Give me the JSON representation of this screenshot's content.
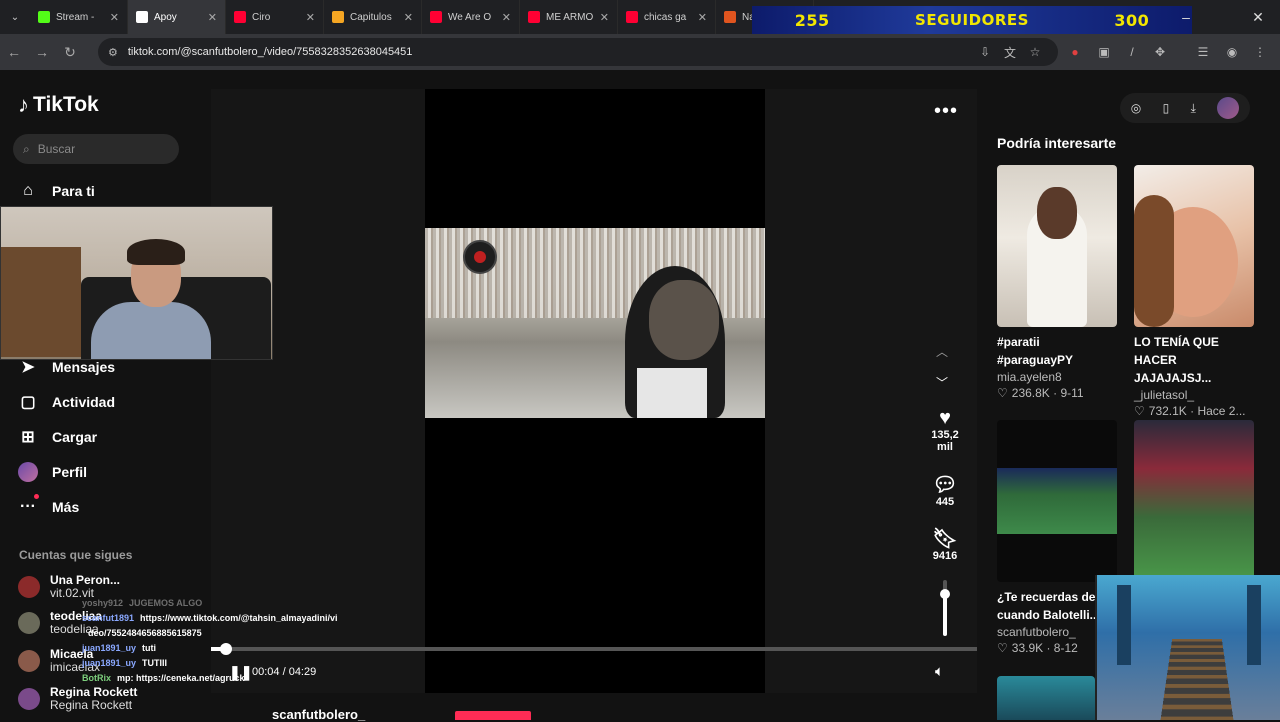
{
  "browser": {
    "tabs": [
      {
        "label": "Stream -",
        "color": "#53fc18",
        "active": false
      },
      {
        "label": "Apoy",
        "color": "#ffffff",
        "active": true
      },
      {
        "label": "Ciro",
        "color": "#ff0033",
        "active": false
      },
      {
        "label": "Capitulos",
        "color": "#f5a623",
        "active": false
      },
      {
        "label": "We Are O",
        "color": "#ff0033",
        "active": false
      },
      {
        "label": "ME ARMO",
        "color": "#ff0033",
        "active": false
      },
      {
        "label": "chicas ga",
        "color": "#ff0033",
        "active": false
      },
      {
        "label": "Naruto",
        "color": "#e0551f",
        "active": false
      }
    ],
    "url": "tiktok.com/@scanfutbolero_/video/7558328352638045451"
  },
  "overlay": {
    "count_left": "255",
    "label": "SEGUIDORES",
    "count_right": "300"
  },
  "sidebar": {
    "logo": "TikTok",
    "search_placeholder": "Buscar",
    "nav": [
      {
        "label": "Para ti",
        "icon": "home-icon"
      },
      {
        "label": "Mensajes",
        "icon": "send-icon"
      },
      {
        "label": "Actividad",
        "icon": "inbox-icon"
      },
      {
        "label": "Cargar",
        "icon": "plus-square-icon"
      },
      {
        "label": "Perfil",
        "icon": "avatar"
      },
      {
        "label": "Más",
        "icon": "more-icon"
      }
    ],
    "following_heading": "Cuentas que sigues",
    "following": [
      {
        "name": "Una Peron...",
        "handle": "vit.02.vit"
      },
      {
        "name": "teodeliaa",
        "handle": "teodeliaa"
      },
      {
        "name": "Micaela",
        "handle": "imicaelax"
      },
      {
        "name": "Regina Rockett",
        "handle": "Regina Rockett"
      }
    ]
  },
  "chat": [
    {
      "user": "yoshy912",
      "msg": "JUGEMOS ALGO",
      "style": "gray"
    },
    {
      "user": "scanfut1891",
      "msg": "https://www.tiktok.com/@tahsin_almayadini/vi",
      "style": "blue"
    },
    {
      "user": "",
      "msg": "deo/7552484656885615875",
      "style": "blue"
    },
    {
      "user": "juan1891_uy",
      "msg": "tuti",
      "style": "blue"
    },
    {
      "user": "juan1891_uy",
      "msg": "TUTIII",
      "style": "blue"
    },
    {
      "user": "BotRix",
      "msg": "mp: https://ceneka.net/agruck",
      "style": "green"
    }
  ],
  "video": {
    "likes": "135,2 mil",
    "comments": "445",
    "saves": "9416",
    "time": "00:04 / 04:29",
    "progress": 0.0149,
    "volume": 0.75,
    "author": "scanfutbolero_"
  },
  "recommendations": {
    "heading": "Podría interesarte",
    "items": [
      {
        "title": "#paratii #paraguayPY",
        "author": "mia.ayelen8",
        "stats": "236.8K · 9-11"
      },
      {
        "title": "LO TENÍA QUE HACER JAJAJAJSJ...",
        "author": "_julietasol_",
        "stats": "732.1K · Hace 2..."
      },
      {
        "title": "¿Te recuerdas de cuando Balotelli...",
        "author": "scanfutbolero_",
        "stats": "33.9K · 8-12"
      }
    ]
  }
}
